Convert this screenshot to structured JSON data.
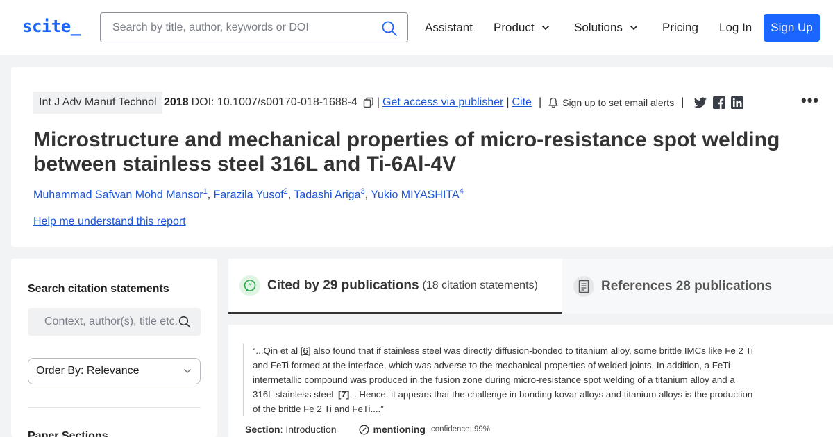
{
  "brand": {
    "logo": "scite_",
    "accent": "#1a66ff"
  },
  "nav": {
    "search_placeholder": "Search by title, author, keywords or DOI",
    "assistant": "Assistant",
    "product": "Product",
    "solutions": "Solutions",
    "pricing": "Pricing",
    "login": "Log In",
    "signup": "Sign Up"
  },
  "paper": {
    "journal": "Int J Adv Manuf Technol",
    "year": "2018",
    "doi": "DOI: 10.1007/s00170-018-1688-4",
    "get_access": "Get access via publisher",
    "cite": "Cite",
    "alerts": "Sign up to set email alerts",
    "title": "Microstructure and mechanical properties of micro-resistance spot welding between stainless steel 316L and Ti-6Al-4V",
    "authors": [
      {
        "name": "Muhammad Safwan Mohd Mansor",
        "sup": "1"
      },
      {
        "name": "Farazila Yusof",
        "sup": "2"
      },
      {
        "name": "Tadashi Ariga",
        "sup": "3"
      },
      {
        "name": "Yukio MIYASHITA",
        "sup": "4"
      }
    ],
    "help_link": "Help me understand this report",
    "share_icons": [
      "twitter-icon",
      "facebook-icon",
      "linkedin-icon"
    ]
  },
  "sidebar": {
    "search_heading": "Search citation statements",
    "context_placeholder": "Context, author(s), title etc.",
    "order_by": "Order By: Relevance",
    "paper_sections": "Paper Sections"
  },
  "tabs": {
    "cited_label": "Cited by 29 publications",
    "cited_sub": "(18 citation statements)",
    "refs_label": "References 28 publications"
  },
  "statement": {
    "text_1": "“...Qin et al ",
    "ref_1": "[6]",
    "text_2": " also found that if stainless steel was directly diffusion-bonded to titanium alloy, some brittle IMCs like Fe 2 Ti and FeTi formed at the interface, which was adverse to the mechanical properties of welded joints. In addition, a FeTi intermetallic compound was produced in the fusion zone during micro-resistance spot welding of a titanium alloy and a 316L stainless steel ",
    "ref_2": "[7]",
    "text_3": " . Hence, it appears that the challenge in bonding kovar alloys and titanium alloys is the production of the brittle Fe 2 Ti and FeTi....”",
    "section_label": "Section",
    "section_value": ": Introduction",
    "type": "mentioning",
    "confidence": "confidence: 99%"
  }
}
